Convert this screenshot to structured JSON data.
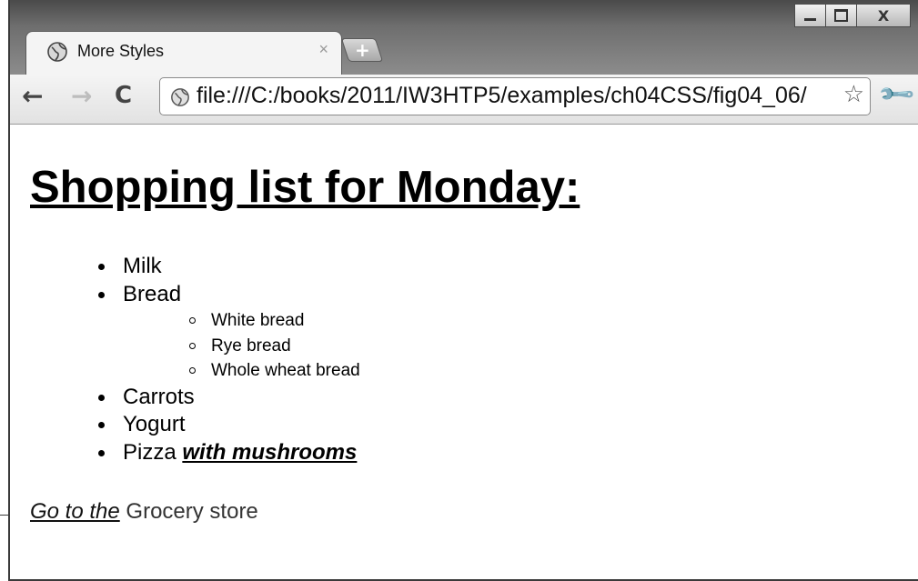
{
  "window": {
    "controls": {
      "minimize": "–",
      "maximize": "□",
      "close": "X"
    }
  },
  "tab": {
    "title": "More Styles",
    "close": "×",
    "new_tab": "+"
  },
  "toolbar": {
    "back": "←",
    "forward": "→",
    "reload": "C",
    "url": "file:///C:/books/2011/IW3HTP5/examples/ch04CSS/fig04_06/",
    "star": "☆",
    "wrench": "🔧"
  },
  "page": {
    "heading": "Shopping list for Monday:",
    "items": {
      "milk": "Milk",
      "bread": "Bread",
      "bread_types": [
        "White bread",
        "Rye bread",
        "Whole wheat bread"
      ],
      "carrots": "Carrots",
      "yogurt": "Yogurt",
      "pizza": "Pizza",
      "pizza_emphasis": "with mushrooms"
    },
    "store_link_prefix": "Go to the",
    "store_text": "Grocery store"
  },
  "colors": {
    "chrome_dark": "#4a4a4a",
    "chrome_light": "#f4f4f4"
  },
  "icons": {
    "favicon": "globe-icon",
    "page_icon": "globe-icon"
  }
}
